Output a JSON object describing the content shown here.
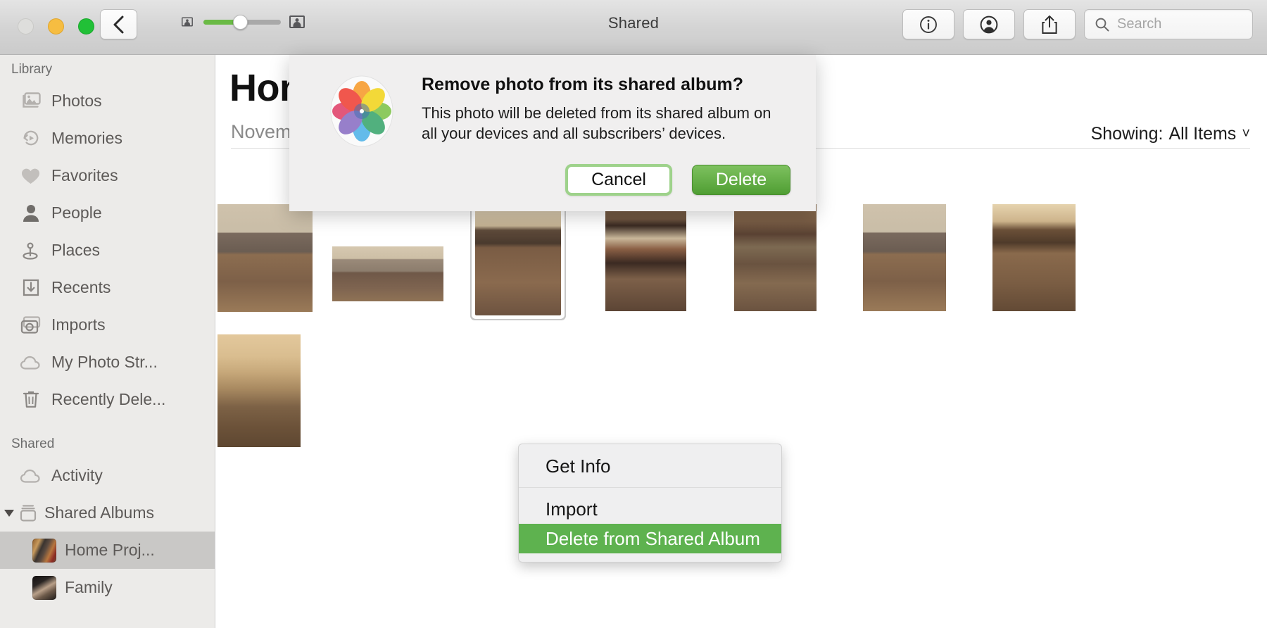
{
  "window": {
    "title": "Shared",
    "traffic_lights": [
      "close",
      "minimize",
      "maximize"
    ]
  },
  "toolbar": {
    "back_label": "Back",
    "zoom_slider_value": 45,
    "info_label": "Info",
    "people_label": "People",
    "share_label": "Share",
    "search_placeholder": "Search",
    "search_value": ""
  },
  "sidebar": {
    "sections": [
      {
        "header": "Library",
        "items": [
          {
            "label": "Photos",
            "icon": "photos-icon",
            "selected": false
          },
          {
            "label": "Memories",
            "icon": "memories-icon",
            "selected": false
          },
          {
            "label": "Favorites",
            "icon": "heart-icon",
            "selected": false
          },
          {
            "label": "People",
            "icon": "person-icon",
            "selected": false
          },
          {
            "label": "Places",
            "icon": "map-pin-icon",
            "selected": false
          },
          {
            "label": "Recents",
            "icon": "download-tray-icon",
            "selected": false
          },
          {
            "label": "Imports",
            "icon": "camera-icon",
            "selected": false
          },
          {
            "label": "My Photo Str...",
            "icon": "cloud-icon",
            "selected": false
          },
          {
            "label": "Recently Dele...",
            "icon": "trash-icon",
            "selected": false
          }
        ]
      },
      {
        "header": "Shared",
        "items": [
          {
            "label": "Activity",
            "icon": "cloud-icon",
            "selected": false
          },
          {
            "label": "Shared Albums",
            "icon": "stack-icon",
            "selected": false,
            "expanded": true
          },
          {
            "label": "Home Proj...",
            "icon": "album-thumbnail",
            "selected": true,
            "indent": true
          },
          {
            "label": "Family",
            "icon": "album-thumbnail",
            "selected": false,
            "indent": true
          }
        ]
      }
    ]
  },
  "main": {
    "album_title": "Home",
    "album_subtitle": "November",
    "showing_label": "Showing:",
    "showing_value": "All Items",
    "photo_count": 8,
    "photos": [
      {
        "name": "living-room-wide",
        "selected": false
      },
      {
        "name": "brown-sofa",
        "selected": false
      },
      {
        "name": "dining-floor",
        "selected": true
      },
      {
        "name": "patterned-rug",
        "selected": false
      },
      {
        "name": "area-rug-floor",
        "selected": false
      },
      {
        "name": "living-room-fan",
        "selected": false
      },
      {
        "name": "dining-room-table",
        "selected": false
      },
      {
        "name": "kitchen-hallway",
        "selected": false
      }
    ]
  },
  "context_menu": {
    "items": [
      {
        "label": "Get Info",
        "highlighted": false
      },
      {
        "label": "Import",
        "highlighted": false
      },
      {
        "label": "Delete from Shared Album",
        "highlighted": true
      }
    ]
  },
  "dialog": {
    "icon": "photos-app-icon",
    "title": "Remove photo from its shared album?",
    "message": "This photo will be deleted from its shared album on all your devices and all subscribers’ devices.",
    "cancel_label": "Cancel",
    "confirm_label": "Delete"
  },
  "colors": {
    "accent_green": "#5eb24f",
    "delete_button": "#4f9e33",
    "sidebar_bg": "#ecebe9",
    "selection_gray": "#c9c8c6",
    "titlebar_bg": "#d3d3d3"
  }
}
